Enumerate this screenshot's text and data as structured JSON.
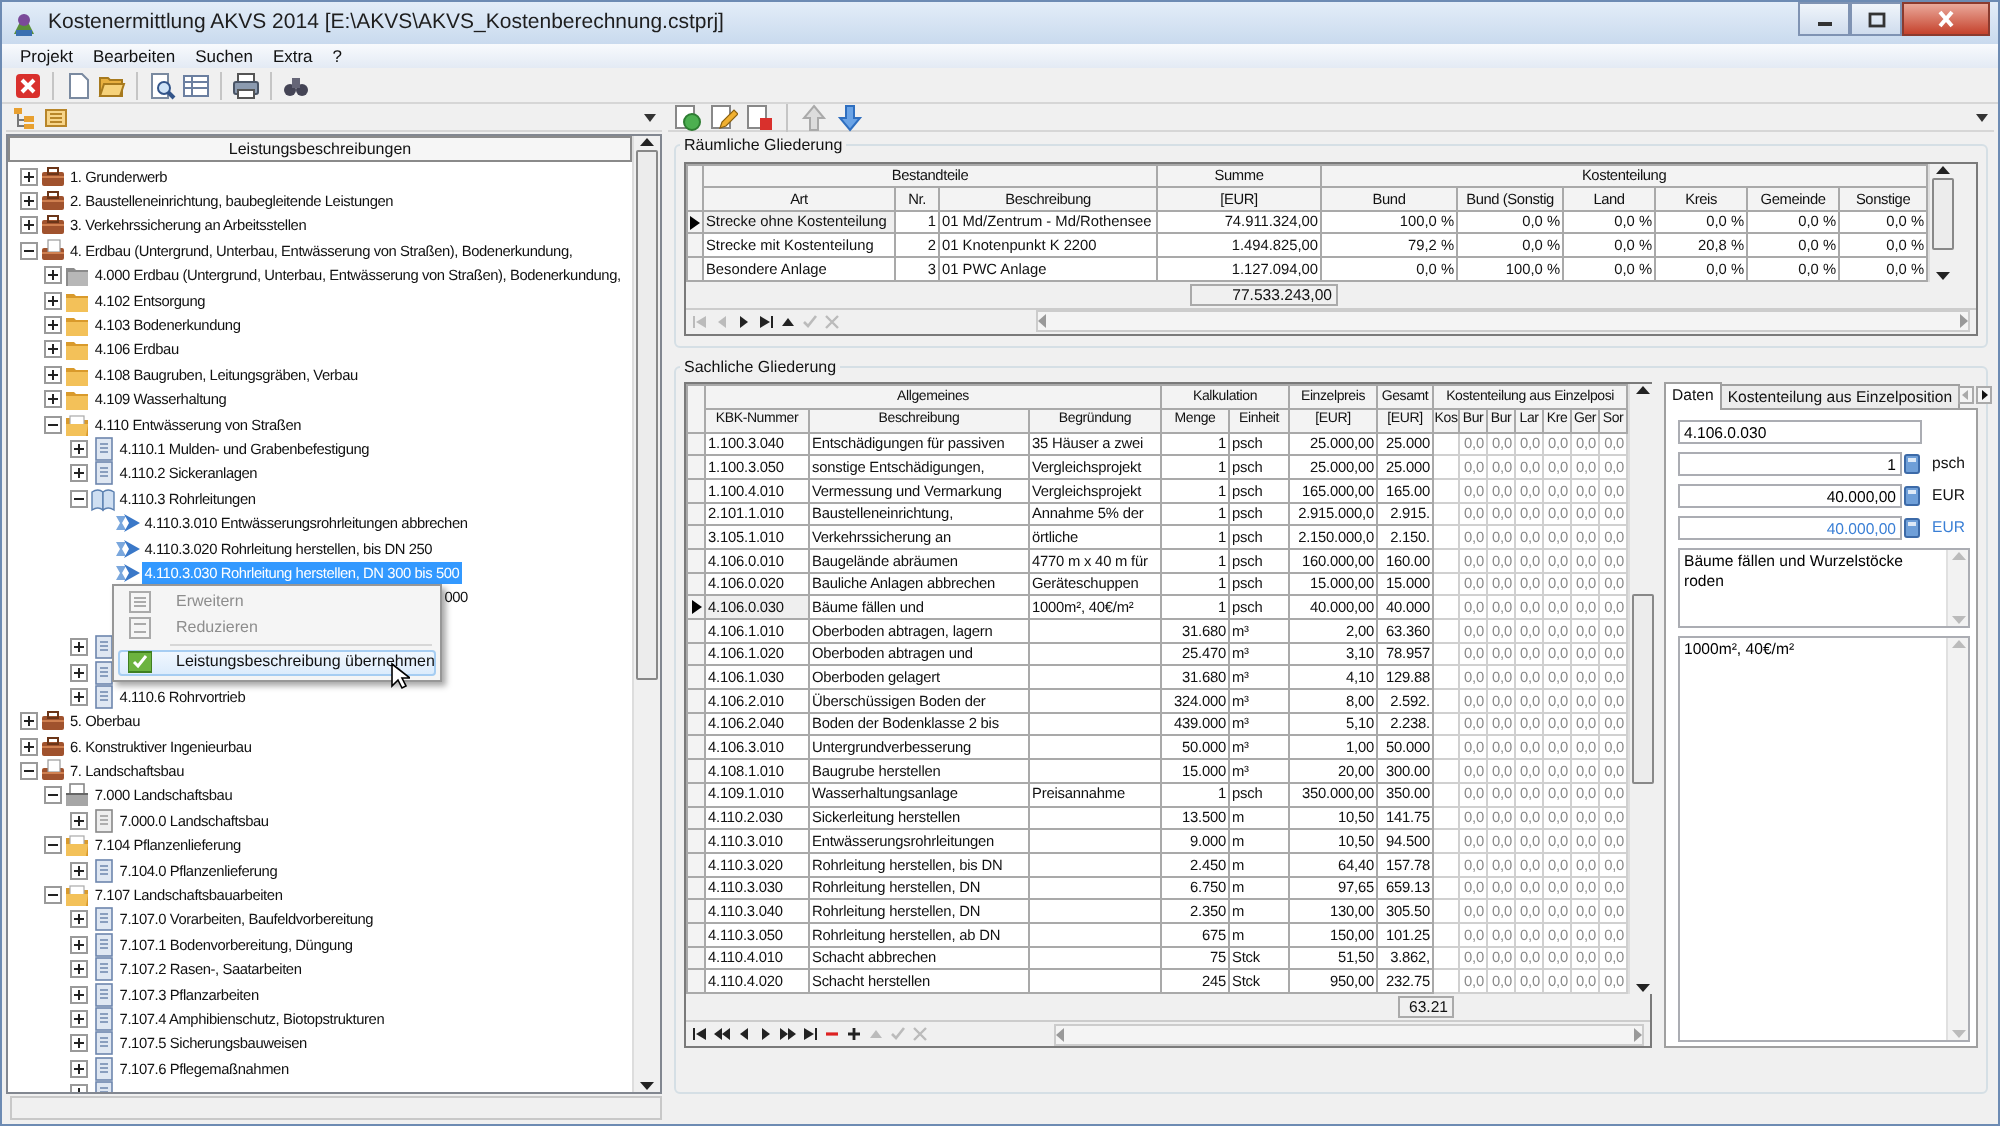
{
  "window": {
    "title": "Kostenermittlung AKVS 2014 [E:\\AKVS\\AKVS_Kostenberechnung.cstprj]"
  },
  "menu": [
    "Projekt",
    "Bearbeiten",
    "Suchen",
    "Extra",
    "?"
  ],
  "tree": {
    "header": "Leistungsbeschreibungen",
    "items": [
      {
        "label": "1. Grunderwerb",
        "kind": "case",
        "expanded": false,
        "selected": false
      },
      {
        "label": "2. Baustelleneinrichtung, baubegleitende Leistungen",
        "kind": "case",
        "expanded": false,
        "selected": false
      },
      {
        "label": "3. Verkehrssicherung an Arbeitsstellen",
        "kind": "case",
        "expanded": false,
        "selected": false
      },
      {
        "label": "4. Erdbau (Untergrund, Unterbau, Entwässerung von Straßen), Bodenerkundung,",
        "kind": "case-open",
        "expanded": true,
        "selected": false,
        "children": [
          {
            "label": "4.000 Erdbau (Untergrund, Unterbau, Entwässerung von Straßen), Bodenerkundung,",
            "kind": "folder-grey",
            "expanded": false,
            "selected": false
          },
          {
            "label": "4.102 Entsorgung",
            "kind": "folder",
            "expanded": false,
            "selected": false
          },
          {
            "label": "4.103 Bodenerkundung",
            "kind": "folder",
            "expanded": false,
            "selected": false
          },
          {
            "label": "4.106 Erdbau",
            "kind": "folder",
            "expanded": false,
            "selected": false
          },
          {
            "label": "4.108 Baugruben, Leitungsgräben, Verbau",
            "kind": "folder",
            "expanded": false,
            "selected": false
          },
          {
            "label": "4.109 Wasserhaltung",
            "kind": "folder",
            "expanded": false,
            "selected": false
          },
          {
            "label": "4.110 Entwässerung von Straßen",
            "kind": "folder-open",
            "expanded": true,
            "selected": false,
            "children": [
              {
                "label": "4.110.1 Mulden- und Grabenbefestigung",
                "kind": "doc",
                "expanded": false,
                "selected": false
              },
              {
                "label": "4.110.2 Sickeranlagen",
                "kind": "doc",
                "expanded": false,
                "selected": false
              },
              {
                "label": "4.110.3 Rohrleitungen",
                "kind": "book",
                "expanded": true,
                "selected": false,
                "children": [
                  {
                    "label": "4.110.3.010 Entwässerungsrohrleitungen abbrechen",
                    "kind": "arrow",
                    "selected": false
                  },
                  {
                    "label": "4.110.3.020 Rohrleitung herstellen, bis DN 250",
                    "kind": "arrow",
                    "selected": false
                  },
                  {
                    "label": "4.110.3.030 Rohrleitung herstellen, DN 300 bis 500",
                    "kind": "arrow",
                    "selected": true
                  },
                  {
                    "tail": "000",
                    "selected": false
                  },
                  {
                    "selected": false
                  }
                ]
              },
              {
                "kind": "doc",
                "expanded": false,
                "selected": false
              },
              {
                "kind": "doc",
                "expanded": false,
                "selected": false
              },
              {
                "label": "4.110.6 Rohrvortrieb",
                "kind": "doc",
                "expanded": false,
                "selected": false
              }
            ]
          }
        ]
      },
      {
        "label": "5. Oberbau",
        "kind": "case",
        "expanded": false,
        "selected": false
      },
      {
        "label": "6. Konstruktiver Ingenieurbau",
        "kind": "case",
        "expanded": false,
        "selected": false
      },
      {
        "label": "7. Landschaftsbau",
        "kind": "case-open",
        "expanded": true,
        "selected": false,
        "children": [
          {
            "label": "7.000 Landschaftsbau",
            "kind": "tray-grey",
            "expanded": true,
            "selected": false,
            "children": [
              {
                "label": "7.000.0 Landschaftsbau",
                "kind": "doc-grey",
                "expanded": false,
                "selected": false
              }
            ]
          },
          {
            "label": "7.104 Pflanzenlieferung",
            "kind": "folder-open",
            "expanded": true,
            "selected": false,
            "children": [
              {
                "label": "7.104.0 Pflanzenlieferung",
                "kind": "doc",
                "expanded": false,
                "selected": false
              }
            ]
          },
          {
            "label": "7.107 Landschaftsbauarbeiten",
            "kind": "folder-open",
            "expanded": true,
            "selected": false,
            "children": [
              {
                "label": "7.107.0 Vorarbeiten, Baufeldvorbereitung",
                "kind": "doc",
                "expanded": false,
                "selected": false
              },
              {
                "label": "7.107.1 Bodenvorbereitung, Düngung",
                "kind": "doc",
                "expanded": false,
                "selected": false
              },
              {
                "label": "7.107.2 Rasen-, Saatarbeiten",
                "kind": "doc",
                "expanded": false,
                "selected": false
              },
              {
                "label": "7.107.3 Pflanzarbeiten",
                "kind": "doc",
                "expanded": false,
                "selected": false
              },
              {
                "label": "7.107.4 Amphibienschutz, Biotopstrukturen",
                "kind": "doc",
                "expanded": false,
                "selected": false
              },
              {
                "label": "7.107.5 Sicherungsbauweisen",
                "kind": "doc",
                "expanded": false,
                "selected": false
              },
              {
                "label": "7.107.6 Pflegemaßnahmen",
                "kind": "doc",
                "expanded": false,
                "selected": false
              },
              {
                "kind": "doc",
                "expanded": false,
                "selected": false
              }
            ]
          }
        ]
      }
    ]
  },
  "context_menu": [
    {
      "kind": "expand",
      "label": "Erweitern",
      "disabled": true,
      "selected": false
    },
    {
      "kind": "collapse",
      "label": "Reduzieren",
      "disabled": true,
      "selected": false
    },
    {
      "kind": "separator"
    },
    {
      "kind": "accept",
      "label": "Leistungsbeschreibung übernehmen",
      "disabled": false,
      "selected": true
    }
  ],
  "raeumliche_gliederung": {
    "title": "Räumliche Gliederung",
    "column_groups": [
      {
        "label": "Bestandteile",
        "columns": [
          "Art",
          "Nr.",
          "Beschreibung"
        ]
      },
      {
        "label": "Summe",
        "columns": [
          "[EUR]"
        ]
      },
      {
        "label": "Kostenteilung",
        "columns": [
          "Bund",
          "Bund (Sonstig",
          "Land",
          "Kreis",
          "Gemeinde",
          "Sonstige"
        ]
      }
    ],
    "rows": [
      {
        "selected": true,
        "cells": [
          "Strecke ohne Kostenteilung",
          "1",
          "01 Md/Zentrum - Md/Rothensee",
          "74.911.324,00",
          "100,0 %",
          "0,0 %",
          "0,0 %",
          "0,0 %",
          "0,0 %",
          "0,0 %"
        ]
      },
      {
        "selected": false,
        "cells": [
          "Strecke mit Kostenteilung",
          "2",
          "01 Knotenpunkt K 2200",
          "1.494.825,00",
          "79,2 %",
          "0,0 %",
          "0,0 %",
          "20,8 %",
          "0,0 %",
          "0,0 %"
        ]
      },
      {
        "selected": false,
        "cells": [
          "Besondere Anlage",
          "3",
          "01 PWC Anlage",
          "1.127.094,00",
          "0,0 %",
          "100,0 %",
          "0,0 %",
          "0,0 %",
          "0,0 %",
          "0,0 %"
        ]
      }
    ],
    "total": "77.533.243,00"
  },
  "sachliche_gliederung": {
    "title": "Sachliche Gliederung",
    "column_groups": [
      {
        "label": "Allgemeines",
        "columns": [
          "KBK-Nummer",
          "Beschreibung",
          "Begründung"
        ]
      },
      {
        "label": "Kalkulation",
        "columns": [
          "Menge",
          "Einheit"
        ]
      },
      {
        "label": "Einzelpreis",
        "columns": [
          "[EUR]"
        ]
      },
      {
        "label": "Gesamt",
        "columns": [
          "[EUR]"
        ]
      },
      {
        "label": "Kostenteilung aus Einzelposi",
        "columns": [
          "Kos",
          "Bur",
          "Bur",
          "Lar",
          "Kre",
          "Ger",
          "Sor"
        ]
      }
    ],
    "rows": [
      {
        "selected": false,
        "cells": [
          "1.100.3.040",
          "Entschädigungen für passiven",
          "35 Häuser a zwei",
          "1",
          "psch",
          "25.000,00",
          "25.000",
          null,
          "0,0",
          "0,0",
          "0,0",
          "0,0",
          "0,0",
          "0,0"
        ]
      },
      {
        "selected": false,
        "cells": [
          "1.100.3.050",
          "sonstige Entschädigungen,",
          "Vergleichsprojekt",
          "1",
          "psch",
          "25.000,00",
          "25.000",
          null,
          "0,0",
          "0,0",
          "0,0",
          "0,0",
          "0,0",
          "0,0"
        ]
      },
      {
        "selected": false,
        "cells": [
          "1.100.4.010",
          "Vermessung und Vermarkung",
          "Vergleichsprojekt",
          "1",
          "psch",
          "165.000,00",
          "165.00",
          null,
          "0,0",
          "0,0",
          "0,0",
          "0,0",
          "0,0",
          "0,0"
        ]
      },
      {
        "selected": false,
        "cells": [
          "2.101.1.010",
          "Baustelleneinrichtung,",
          "Annahme 5% der",
          "1",
          "psch",
          "2.915.000,0",
          "2.915.",
          null,
          "0,0",
          "0,0",
          "0,0",
          "0,0",
          "0,0",
          "0,0"
        ]
      },
      {
        "selected": false,
        "cells": [
          "3.105.1.010",
          "Verkehrssicherung an",
          "örtliche",
          "1",
          "psch",
          "2.150.000,0",
          "2.150.",
          null,
          "0,0",
          "0,0",
          "0,0",
          "0,0",
          "0,0",
          "0,0"
        ]
      },
      {
        "selected": false,
        "cells": [
          "4.106.0.010",
          "Baugelände abräumen",
          "4770 m x 40 m für",
          "1",
          "psch",
          "160.000,00",
          "160.00",
          null,
          "0,0",
          "0,0",
          "0,0",
          "0,0",
          "0,0",
          "0,0"
        ]
      },
      {
        "selected": false,
        "cells": [
          "4.106.0.020",
          "Bauliche Anlagen abbrechen",
          "Geräteschuppen",
          "1",
          "psch",
          "15.000,00",
          "15.000",
          null,
          "0,0",
          "0,0",
          "0,0",
          "0,0",
          "0,0",
          "0,0"
        ]
      },
      {
        "selected": true,
        "cells": [
          "4.106.0.030",
          "Bäume fällen und",
          "1000m², 40€/m²",
          "1",
          "psch",
          "40.000,00",
          "40.000",
          null,
          "0,0",
          "0,0",
          "0,0",
          "0,0",
          "0,0",
          "0,0"
        ]
      },
      {
        "selected": false,
        "cells": [
          "4.106.1.010",
          "Oberboden abtragen, lagern",
          null,
          "31.680",
          "m³",
          "2,00",
          "63.360",
          null,
          "0,0",
          "0,0",
          "0,0",
          "0,0",
          "0,0",
          "0,0"
        ]
      },
      {
        "selected": false,
        "cells": [
          "4.106.1.020",
          "Oberboden abtragen und",
          null,
          "25.470",
          "m³",
          "3,10",
          "78.957",
          null,
          "0,0",
          "0,0",
          "0,0",
          "0,0",
          "0,0",
          "0,0"
        ]
      },
      {
        "selected": false,
        "cells": [
          "4.106.1.030",
          "Oberboden gelagert",
          null,
          "31.680",
          "m³",
          "4,10",
          "129.88",
          null,
          "0,0",
          "0,0",
          "0,0",
          "0,0",
          "0,0",
          "0,0"
        ]
      },
      {
        "selected": false,
        "cells": [
          "4.106.2.010",
          "Überschüssigen Boden der",
          null,
          "324.000",
          "m³",
          "8,00",
          "2.592.",
          null,
          "0,0",
          "0,0",
          "0,0",
          "0,0",
          "0,0",
          "0,0"
        ]
      },
      {
        "selected": false,
        "cells": [
          "4.106.2.040",
          "Boden der Bodenklasse 2 bis",
          null,
          "439.000",
          "m³",
          "5,10",
          "2.238.",
          null,
          "0,0",
          "0,0",
          "0,0",
          "0,0",
          "0,0",
          "0,0"
        ]
      },
      {
        "selected": false,
        "cells": [
          "4.106.3.010",
          "Untergrundverbesserung",
          null,
          "50.000",
          "m³",
          "1,00",
          "50.000",
          null,
          "0,0",
          "0,0",
          "0,0",
          "0,0",
          "0,0",
          "0,0"
        ]
      },
      {
        "selected": false,
        "cells": [
          "4.108.1.010",
          "Baugrube herstellen",
          null,
          "15.000",
          "m³",
          "20,00",
          "300.00",
          null,
          "0,0",
          "0,0",
          "0,0",
          "0,0",
          "0,0",
          "0,0"
        ]
      },
      {
        "selected": false,
        "cells": [
          "4.109.1.010",
          "Wasserhaltungsanlage",
          "Preisannahme",
          "1",
          "psch",
          "350.000,00",
          "350.00",
          null,
          "0,0",
          "0,0",
          "0,0",
          "0,0",
          "0,0",
          "0,0"
        ]
      },
      {
        "selected": false,
        "cells": [
          "4.110.2.030",
          "Sickerleitung herstellen",
          null,
          "13.500",
          "m",
          "10,50",
          "141.75",
          null,
          "0,0",
          "0,0",
          "0,0",
          "0,0",
          "0,0",
          "0,0"
        ]
      },
      {
        "selected": false,
        "cells": [
          "4.110.3.010",
          "Entwässerungsrohrleitungen",
          null,
          "9.000",
          "m",
          "10,50",
          "94.500",
          null,
          "0,0",
          "0,0",
          "0,0",
          "0,0",
          "0,0",
          "0,0"
        ]
      },
      {
        "selected": false,
        "cells": [
          "4.110.3.020",
          "Rohrleitung herstellen, bis DN",
          null,
          "2.450",
          "m",
          "64,40",
          "157.78",
          null,
          "0,0",
          "0,0",
          "0,0",
          "0,0",
          "0,0",
          "0,0"
        ]
      },
      {
        "selected": false,
        "cells": [
          "4.110.3.030",
          "Rohrleitung herstellen, DN",
          null,
          "6.750",
          "m",
          "97,65",
          "659.13",
          null,
          "0,0",
          "0,0",
          "0,0",
          "0,0",
          "0,0",
          "0,0"
        ]
      },
      {
        "selected": false,
        "cells": [
          "4.110.3.040",
          "Rohrleitung herstellen, DN",
          null,
          "2.350",
          "m",
          "130,00",
          "305.50",
          null,
          "0,0",
          "0,0",
          "0,0",
          "0,0",
          "0,0",
          "0,0"
        ]
      },
      {
        "selected": false,
        "cells": [
          "4.110.3.050",
          "Rohrleitung herstellen, ab DN",
          null,
          "675",
          "m",
          "150,00",
          "101.25",
          null,
          "0,0",
          "0,0",
          "0,0",
          "0,0",
          "0,0",
          "0,0"
        ]
      },
      {
        "selected": false,
        "cells": [
          "4.110.4.010",
          "Schacht abbrechen",
          null,
          "75",
          "Stck",
          "51,50",
          "3.862,",
          null,
          "0,0",
          "0,0",
          "0,0",
          "0,0",
          "0,0",
          "0,0"
        ]
      },
      {
        "selected": false,
        "cells": [
          "4.110.4.020",
          "Schacht herstellen",
          null,
          "245",
          "Stck",
          "950,00",
          "232.75",
          null,
          "0,0",
          "0,0",
          "0,0",
          "0,0",
          "0,0",
          "0,0"
        ]
      }
    ],
    "total": "63.21"
  },
  "detail": {
    "tabs": [
      {
        "label": "Daten",
        "selected": true
      },
      {
        "label": "Kostenteilung aus Einzelposition",
        "selected": false
      }
    ],
    "fields": [
      {
        "kind": "text",
        "value": "4.106.0.030"
      },
      {
        "kind": "number",
        "value": "1",
        "unit": "psch"
      },
      {
        "kind": "number",
        "value": "40.000,00",
        "unit": "EUR"
      },
      {
        "kind": "computed",
        "value": "40.000,00",
        "unit": "EUR"
      }
    ],
    "description": "Bäume fällen und Wurzelstöcke roden",
    "note": "1000m², 40€/m²"
  }
}
